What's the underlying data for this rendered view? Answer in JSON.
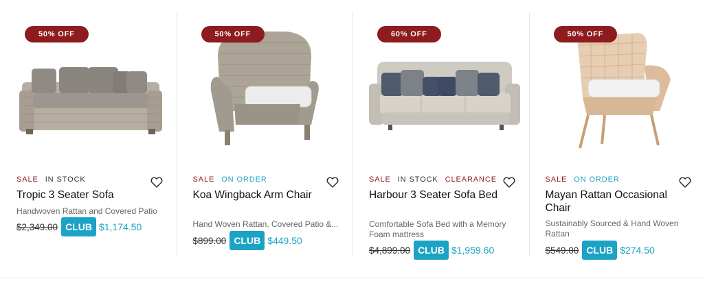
{
  "products": [
    {
      "badge": "50% OFF",
      "tags": [
        "SALE",
        "IN STOCK"
      ],
      "name": "Tropic 3 Seater Sofa",
      "description": "Handwoven Rattan and Covered Patio",
      "was_price": "$2,349.00",
      "club_label": "CLUB",
      "club_price": "$1,174.50",
      "icon": "heart-outline-icon"
    },
    {
      "badge": "50% OFF",
      "tags": [
        "SALE",
        "ON ORDER"
      ],
      "name": "Koa Wingback Arm Chair",
      "description": "Hand Woven Rattan, Covered Patio &...",
      "was_price": "$899.00",
      "club_label": "CLUB",
      "club_price": "$449.50",
      "icon": "heart-outline-icon"
    },
    {
      "badge": "60% OFF",
      "tags": [
        "SALE",
        "IN STOCK",
        "CLEARANCE"
      ],
      "name": "Harbour 3 Seater Sofa Bed",
      "description": "Comfortable Sofa Bed with a Memory Foam mattress",
      "was_price": "$4,899.00",
      "club_label": "CLUB",
      "club_price": "$1,959.60",
      "icon": "heart-outline-icon"
    },
    {
      "badge": "50% OFF",
      "tags": [
        "SALE",
        "ON ORDER"
      ],
      "name": "Mayan Rattan Occasional Chair",
      "description": "Sustainably Sourced & Hand Woven Rattan",
      "was_price": "$549.00",
      "club_label": "CLUB",
      "club_price": "$274.50",
      "icon": "heart-outline-icon"
    }
  ],
  "colors": {
    "sale_red": "#8e1b1e",
    "club_blue": "#1ba3c6",
    "on_order_blue": "#1ba3c6"
  }
}
